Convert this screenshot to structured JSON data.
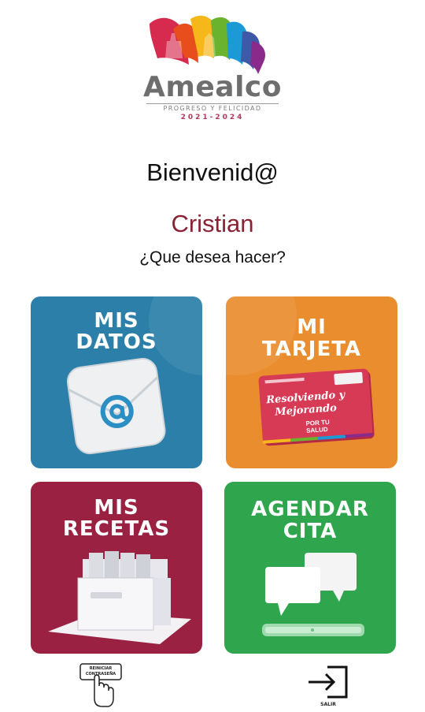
{
  "brand": {
    "name": "Amealco",
    "tagline": "PROGRESO Y FELICIDAD",
    "years": "2021-2024",
    "colors": [
      "#d62a4f",
      "#e84e1c",
      "#f5b71a",
      "#69b32f",
      "#1b9ad6",
      "#3d5aa8",
      "#8a2a8a"
    ]
  },
  "welcome": "Bienvenid@",
  "user_name": "Cristian",
  "question": "¿Que desea hacer?",
  "tiles": [
    {
      "label_line1": "MIS",
      "label_line2": "DATOS",
      "icon": "email-envelope-icon",
      "color": "#2b7fa8"
    },
    {
      "label_line1": "MI",
      "label_line2": "TARJETA",
      "icon": "health-card-icon",
      "color": "#ea8d2f",
      "card_text1": "Resolviendo y",
      "card_text2": "Mejorando",
      "card_badge1": "POR TU",
      "card_badge2": "SALUD"
    },
    {
      "label_line1": "MIS",
      "label_line2": "RECETAS",
      "icon": "file-drawer-icon",
      "color": "#9b2142"
    },
    {
      "label_line1": "AGENDAR",
      "label_line2": "CITA",
      "icon": "chat-bubbles-phone-icon",
      "color": "#2fa64d"
    }
  ],
  "footer": {
    "reset_password_line1": "REINICIAR",
    "reset_password_line2": "CONTRASEÑA",
    "logout": "SALIR"
  }
}
